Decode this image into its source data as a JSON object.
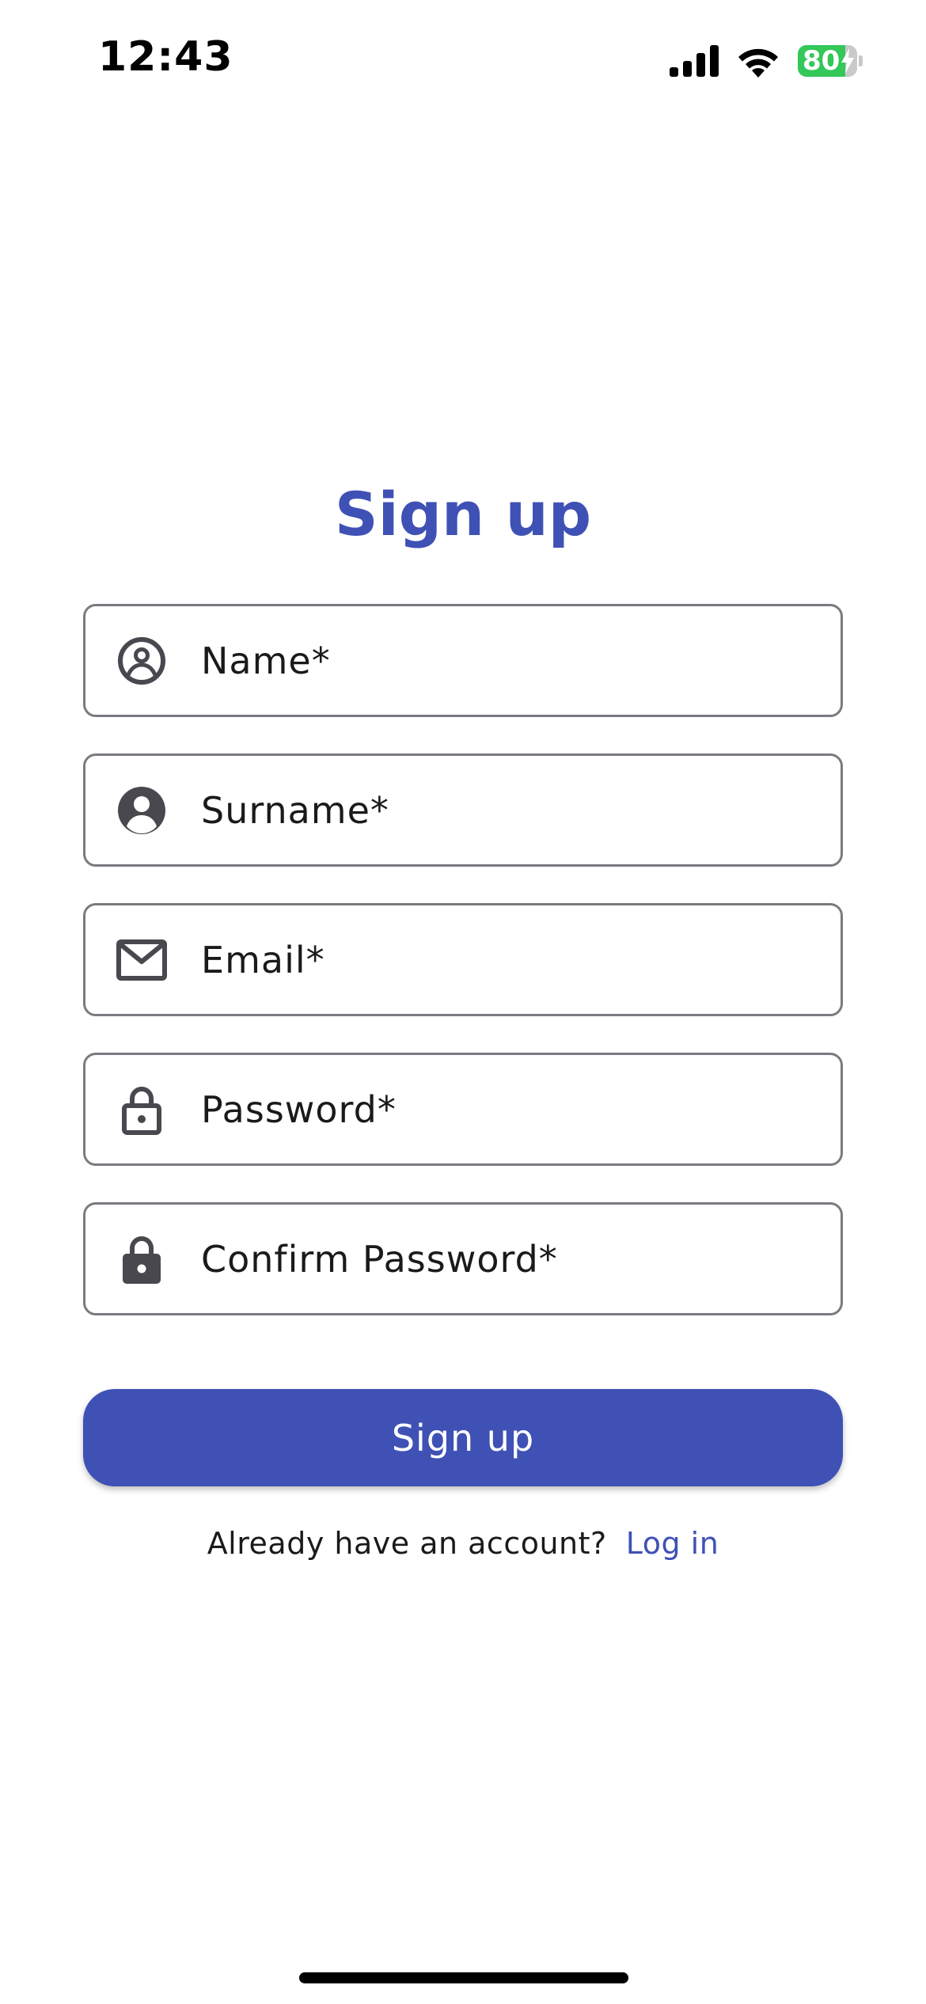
{
  "status_bar": {
    "time": "12:43",
    "battery_level": "80",
    "battery_fraction": 0.8,
    "battery_charging": true,
    "battery_color": "#34c759"
  },
  "title": "Sign up",
  "fields": [
    {
      "placeholder": "Name*",
      "icon": "person-circle-outline-icon"
    },
    {
      "placeholder": "Surname*",
      "icon": "person-circle-filled-icon"
    },
    {
      "placeholder": "Email*",
      "icon": "mail-icon"
    },
    {
      "placeholder": "Password*",
      "icon": "lock-outline-icon"
    },
    {
      "placeholder": "Confirm Password*",
      "icon": "lock-filled-icon"
    }
  ],
  "signup_button": "Sign up",
  "login_prompt": {
    "text": "Already have an account?",
    "link": "Log in"
  },
  "colors": {
    "accent": "#3f51b5",
    "border": "#7a7a80",
    "icon": "#48484e"
  }
}
